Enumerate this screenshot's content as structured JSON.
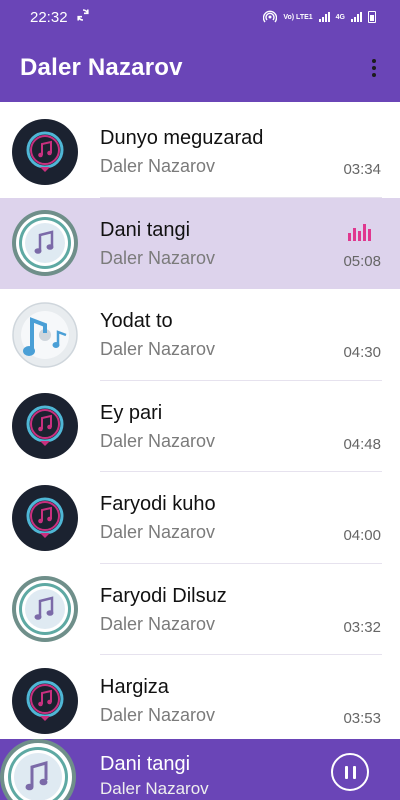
{
  "status_bar": {
    "time": "22:32",
    "network": "Vo) LTE1",
    "net_type": "4G"
  },
  "header": {
    "title": "Daler Nazarov"
  },
  "songs": [
    {
      "title": "Dunyo meguzarad",
      "artist": "Daler Nazarov",
      "duration": "03:34",
      "icon": "dark-music-note-icon",
      "playing": false
    },
    {
      "title": "Dani tangi",
      "artist": "Daler Nazarov",
      "duration": "05:08",
      "icon": "teal-music-disc-icon",
      "playing": true
    },
    {
      "title": "Yodat to",
      "artist": "Daler Nazarov",
      "duration": "04:30",
      "icon": "blue-music-cd-icon",
      "playing": false
    },
    {
      "title": "Ey pari",
      "artist": "Daler Nazarov",
      "duration": "04:48",
      "icon": "dark-music-note-icon",
      "playing": false
    },
    {
      "title": "Faryodi kuho",
      "artist": "Daler Nazarov",
      "duration": "04:00",
      "icon": "dark-music-note-icon",
      "playing": false
    },
    {
      "title": "Faryodi Dilsuz",
      "artist": "Daler Nazarov",
      "duration": "03:32",
      "icon": "teal-music-disc-icon",
      "playing": false
    },
    {
      "title": "Hargiza",
      "artist": "Daler Nazarov",
      "duration": "03:53",
      "icon": "dark-music-note-icon",
      "playing": false
    }
  ],
  "now_playing": {
    "title": "Dani tangi",
    "artist": "Daler Nazarov"
  },
  "colors": {
    "primary": "#6a45b7",
    "active_row": "#ddd3ec",
    "accent": "#e0378f"
  }
}
